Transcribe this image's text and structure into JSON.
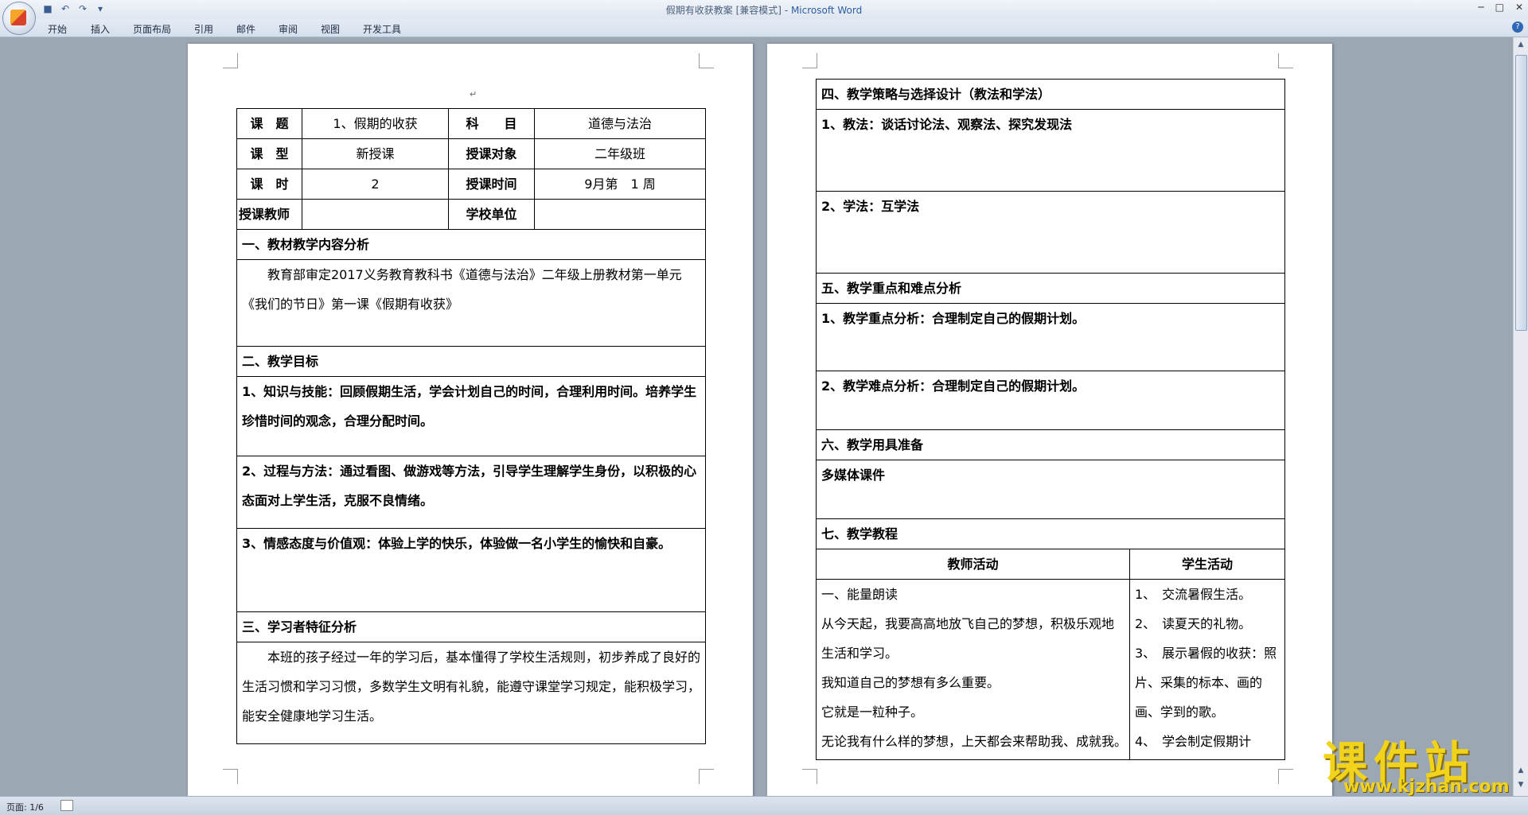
{
  "window": {
    "doc_title": "假期有收获教案 [兼容模式]",
    "separator": " - ",
    "app_name": "Microsoft Word"
  },
  "ribbon": {
    "tabs": [
      "开始",
      "插入",
      "页面布局",
      "引用",
      "邮件",
      "审阅",
      "视图",
      "开发工具"
    ]
  },
  "status": {
    "page": "页面: 1/6"
  },
  "page1": {
    "header_row1": [
      "课　题",
      "1、假期的收获",
      "科　　目",
      "道德与法治"
    ],
    "header_row2": [
      "课　型",
      "新授课",
      "授课对象",
      "二年级班"
    ],
    "header_row3": [
      "课　时",
      "2",
      "授课时间",
      "9月第　1 周"
    ],
    "header_row4": [
      "授课教师",
      "",
      "学校单位",
      ""
    ],
    "sec1_title": "一、教材教学内容分析",
    "sec1_body": "教育部审定2017义务教育教科书《道德与法治》二年级上册教材第一单元《我们的节日》第一课《假期有收获》",
    "sec2_title": "二、教学目标",
    "goal1": "1、知识与技能：回顾假期生活，学会计划自己的时间，合理利用时间。培养学生珍惜时间的观念，合理分配时间。",
    "goal2": "2、过程与方法：通过看图、做游戏等方法，引导学生理解学生身份，以积极的心态面对上学生活，克服不良情绪。",
    "goal3": "3、情感态度与价值观：体验上学的快乐，体验做一名小学生的愉快和自豪。",
    "sec3_title": "三、学习者特征分析",
    "sec3_body": "本班的孩子经过一年的学习后，基本懂得了学校生活规则，初步养成了良好的生活习惯和学习习惯，多数学生文明有礼貌，能遵守课堂学习规定，能积极学习，能安全健康地学习生活。"
  },
  "page2": {
    "sec4_title": "四、教学策略与选择设计（教法和学法）",
    "method1": "1、教法：谈话讨论法、观察法、探究发现法",
    "method2": "2、学法：互学法",
    "sec5_title": "五、教学重点和难点分析",
    "key1": "1、教学重点分析：合理制定自己的假期计划。",
    "key2": "2、教学难点分析：合理制定自己的假期计划。",
    "sec6_title": "六、教学用具准备",
    "tools": "多媒体课件",
    "sec7_title": "七、教学教程",
    "col_teacher": "教师活动",
    "col_student": "学生活动",
    "teacher_lines": [
      "一、能量朗读",
      "从今天起，我要高高地放飞自己的梦想，积极乐观地生活和学习。",
      "我知道自己的梦想有多么重要。",
      "它就是一粒种子。",
      "无论我有什么样的梦想，上天都会来帮助我、成就我。"
    ],
    "student_lines": [
      "1、　交流暑假生活。",
      "2、　读夏天的礼物。",
      "3、　展示暑假的收获：照片、采集的标本、画的画、学到的歌。",
      "4、　学会制定假期计"
    ]
  },
  "watermark": {
    "title": "课件站",
    "url": "www.kjzhan.com"
  }
}
